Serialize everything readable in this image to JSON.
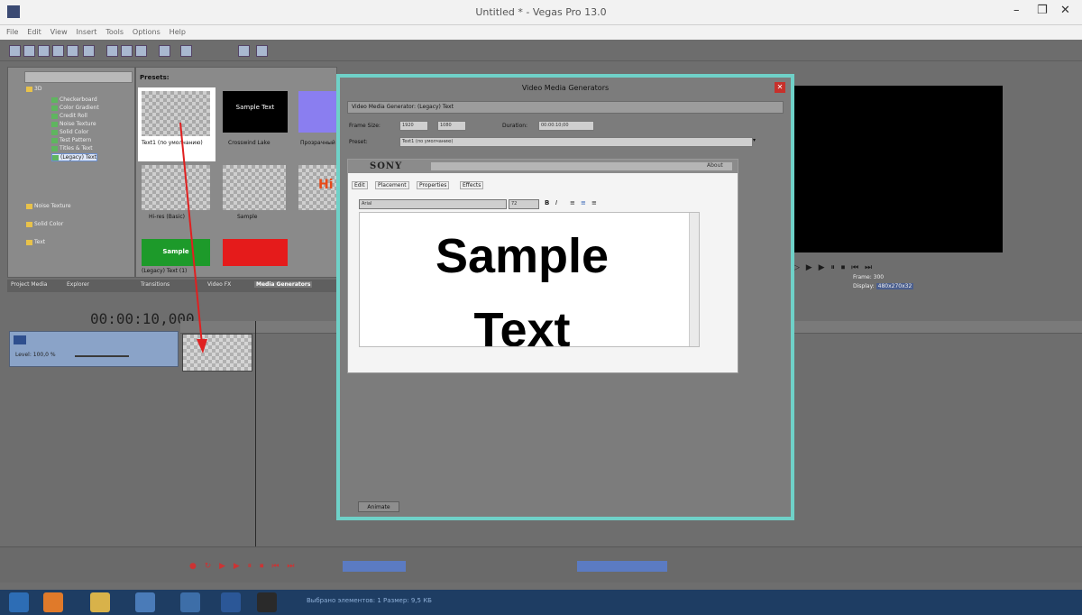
{
  "window": {
    "title": "Untitled * - Vegas Pro 13.0"
  },
  "menu": [
    "File",
    "Edit",
    "View",
    "Insert",
    "Tools",
    "Options",
    "Help"
  ],
  "explorer": {
    "tree": [
      "3D",
      "Checkerboard",
      "Color Gradient",
      "Credit Roll",
      "Noise Texture",
      "Solid Color",
      "Test Pattern",
      "Titles & Text",
      "(Legacy) Text",
      "Noise Texture",
      "Solid Color",
      "Text"
    ],
    "selected": "(Legacy) Text"
  },
  "presets": {
    "header": "Presets:",
    "items": [
      {
        "label": "Text1 (по умолчанию)",
        "kind": "checker"
      },
      {
        "label": "Crosswind Lake",
        "kind": "sample-black",
        "text": "Sample Text"
      },
      {
        "label": "Прозрачный",
        "kind": "purple"
      },
      {
        "label": "Hi-res (Basic)",
        "kind": "checker"
      },
      {
        "label": "Sample",
        "kind": "checker"
      },
      {
        "label": "Hi",
        "kind": "red-hi"
      },
      {
        "label": "(Legacy) Text (1)",
        "kind": "green",
        "text": "Sample"
      },
      {
        "label": "",
        "kind": "red"
      }
    ]
  },
  "tabs": [
    "Project Media",
    "Explorer",
    "Transitions",
    "Video FX",
    "Media Generators"
  ],
  "active_tab": "Media Generators",
  "preview": {
    "frame_label": "Frame:",
    "frame": "300",
    "display_label": "Display:",
    "display": "480x270x32"
  },
  "timeline": {
    "timecode": "00:00:10,000",
    "track_level": "Level: 100,0 %"
  },
  "dialog": {
    "title": "Video Media Generators",
    "vmg_label": "Video Media Generator:",
    "vmg_value": "(Legacy) Text",
    "frame_size_label": "Frame Size:",
    "width": "1920",
    "height": "1080",
    "duration_label": "Duration:",
    "duration": "00:00:10;00",
    "preset_label": "Preset:",
    "preset_value": "Text1 (по умолчанию)",
    "plugin_brand": "SONY",
    "plugin_about": "About",
    "subtabs": [
      "Edit",
      "Placement",
      "Properties",
      "Effects"
    ],
    "font": "Arial",
    "size": "72",
    "sample_line1": "Sample",
    "sample_line2": "Text",
    "animate_label": "Animate"
  },
  "taskbar": {
    "status": "Выбрано элементов: 1 Размер: 9,5 КБ"
  }
}
